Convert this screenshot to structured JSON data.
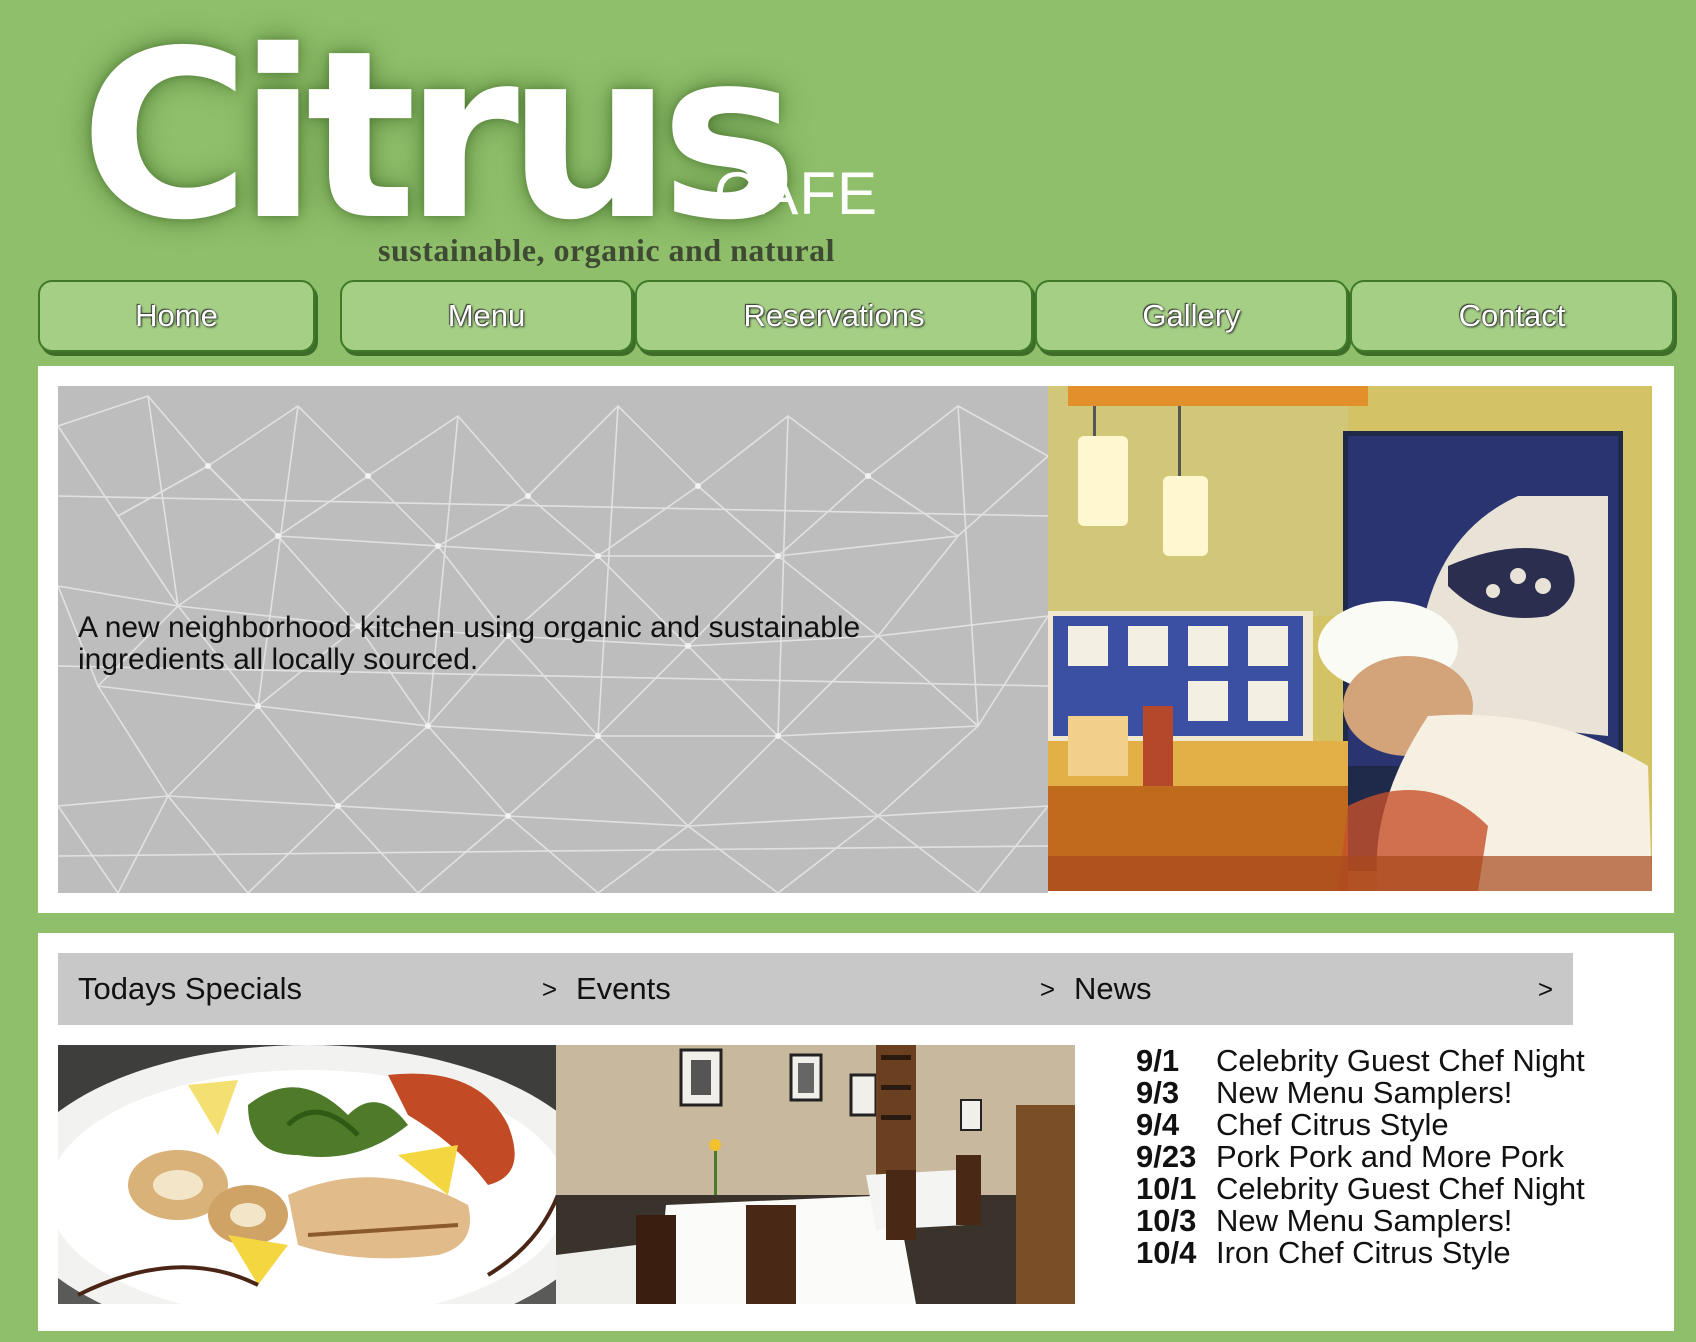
{
  "logo": {
    "word": "Citrus",
    "cafe": "CAFE",
    "tagline": "sustainable, organic and natural"
  },
  "nav": {
    "items": [
      {
        "label": "Home"
      },
      {
        "label": "Menu"
      },
      {
        "label": "Reservations"
      },
      {
        "label": "Gallery"
      },
      {
        "label": "Contact"
      }
    ]
  },
  "hero": {
    "text": "A new neighborhood kitchen using organic and sustainable ingredients all locally sourced."
  },
  "sections": [
    {
      "title": "Todays Specials",
      "arrow": ">"
    },
    {
      "title": "Events",
      "arrow": ">"
    },
    {
      "title": "News",
      "arrow": ">"
    }
  ],
  "news": {
    "items": [
      {
        "date": "9/1",
        "title": "Celebrity Guest Chef Night"
      },
      {
        "date": "9/3",
        "title": "New Menu Samplers!"
      },
      {
        "date": "9/4",
        "title": "Chef Citrus Style"
      },
      {
        "date": "9/23",
        "title": "Pork Pork and More Pork"
      },
      {
        "date": "10/1",
        "title": "Celebrity Guest Chef Night"
      },
      {
        "date": "10/3",
        "title": "New Menu Samplers!"
      },
      {
        "date": "10/4",
        "title": "Iron Chef Citrus Style"
      }
    ]
  },
  "colors": {
    "page_bg": "#8fbf6a",
    "nav_bg": "#a6cf86",
    "nav_border": "#3e7a28",
    "section_header_bg": "#c8c8c8",
    "pattern_bg": "#bdbdbd"
  }
}
